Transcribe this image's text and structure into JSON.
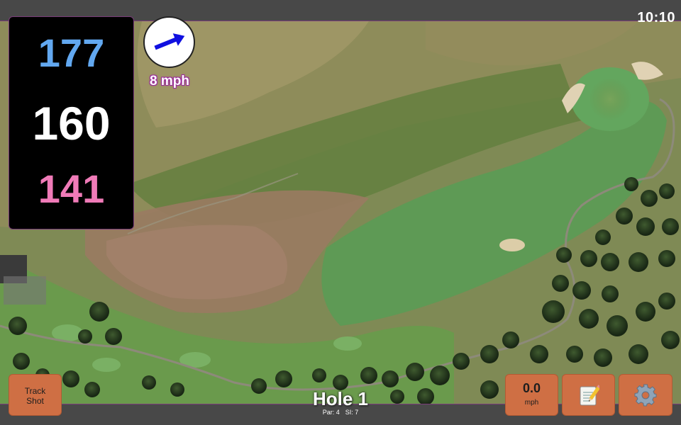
{
  "status": {
    "time": "10:10"
  },
  "yardage": {
    "back": "177",
    "middle": "160",
    "front": "141"
  },
  "wind": {
    "speed": "8 mph",
    "arrow_icon": "arrow-icon",
    "direction_note": "arrow pointing up-right"
  },
  "buttons": {
    "track_shot": {
      "line1": "Track",
      "line2": "Shot"
    },
    "speed": {
      "value": "0.0",
      "unit": "mph"
    },
    "notes": {
      "icon": "notepad-icon"
    },
    "settings": {
      "icon": "gear-icon"
    }
  },
  "hole": {
    "title": "Hole 1",
    "par": "Par: 4",
    "si": "SI: 7"
  },
  "colors": {
    "back_yardage": "#62a8f0",
    "middle_yardage": "#ffffff",
    "front_yardage": "#f07bb8",
    "button": "#cf6f44",
    "wind_arrow": "#1010e0"
  }
}
